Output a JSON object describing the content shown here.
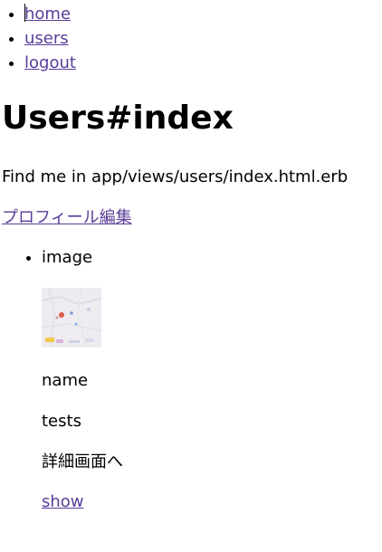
{
  "nav": {
    "home": "home",
    "users": "users",
    "logout": "logout"
  },
  "page": {
    "title": "Users#index",
    "path_text": "Find me in app/views/users/index.html.erb",
    "profile_edit": "プロフィール編集"
  },
  "user": {
    "image_label": "image",
    "name_label": "name",
    "name_value": "tests",
    "detail_text": "詳細画面へ",
    "show_link": "show"
  },
  "colors": {
    "link": "#5a3d9a"
  }
}
